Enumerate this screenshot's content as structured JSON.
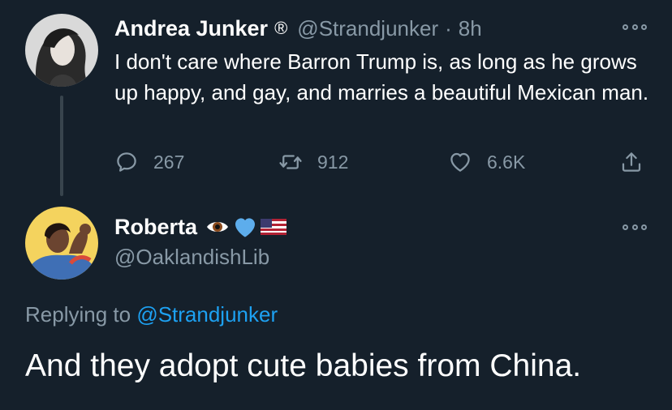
{
  "tweet1": {
    "display_name": "Andrea Junker",
    "registered_symbol": "®",
    "handle": "@Strandjunker",
    "separator": "·",
    "time": "8h",
    "text": "I don't care where Barron Trump is, as long as he grows up happy, and gay, and marries a beautiful Mexican man.",
    "actions": {
      "replies": "267",
      "retweets": "912",
      "likes": "6.6K"
    },
    "icons": {
      "reply": "speech-bubble-icon",
      "retweet": "retweet-arrows-icon",
      "like": "heart-icon",
      "share": "share-upload-icon",
      "more": "more-options-icon"
    }
  },
  "tweet2": {
    "display_name": "Roberta",
    "handle": "@OaklandishLib",
    "badges": [
      "eye-emoji",
      "blue-heart-emoji",
      "us-flag-emoji"
    ],
    "replying_prefix": "Replying to",
    "replying_to": "@Strandjunker",
    "text": "And they adopt cute babies from China."
  },
  "colors": {
    "background": "#15202b",
    "secondary_text": "#8899a6",
    "link": "#1da1f2",
    "thread_line": "#38444d"
  }
}
